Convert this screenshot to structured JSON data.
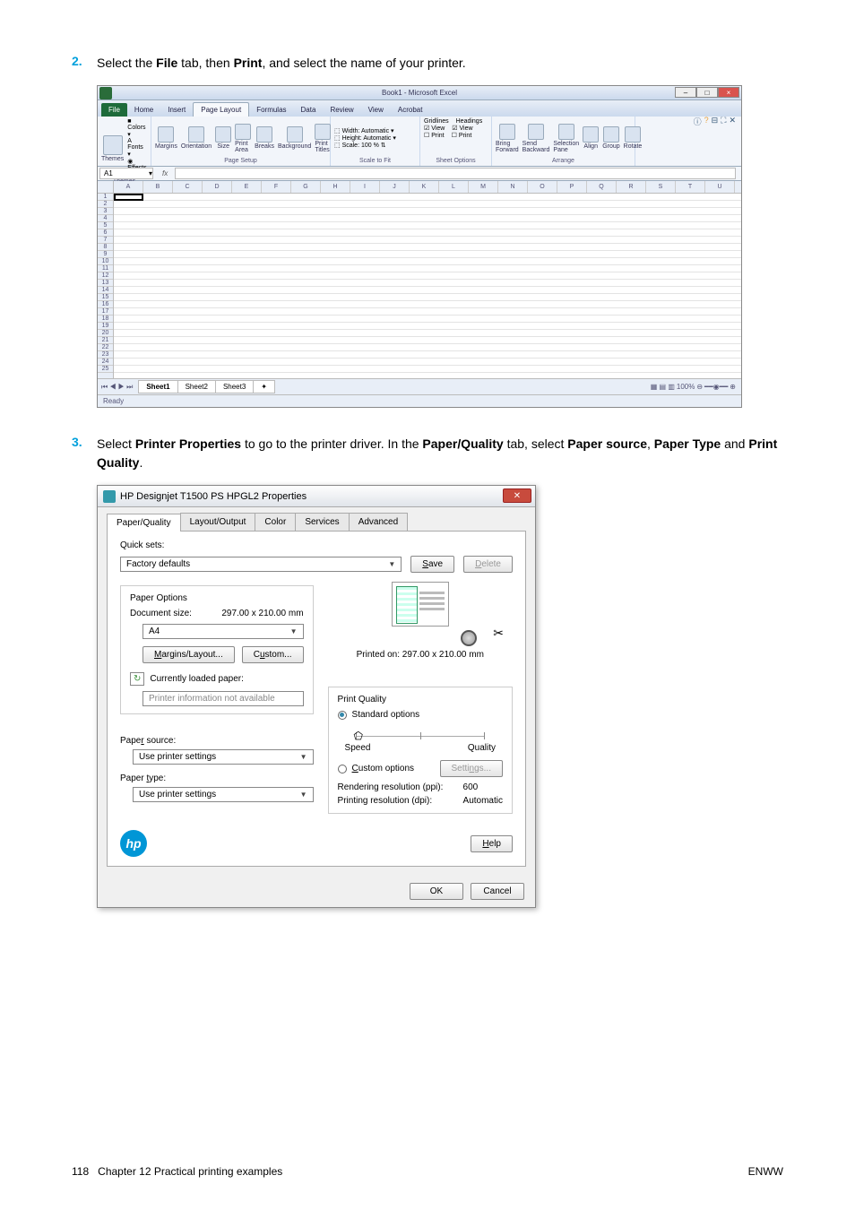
{
  "steps": {
    "s2": {
      "num": "2.",
      "text_before": "Select the ",
      "file": "File",
      "mid1": " tab, then ",
      "print": "Print",
      "after": ", and select the name of your printer."
    },
    "s3": {
      "num": "3.",
      "text_before": "Select ",
      "pp": "Printer Properties",
      "mid1": " to go to the printer driver. In the ",
      "pq": "Paper/Quality",
      "mid2": " tab, select ",
      "ps": "Paper source",
      "comma": ", ",
      "pt": "Paper Type",
      "and": " and ",
      "pq2": "Print Quality",
      "dot": "."
    }
  },
  "excel": {
    "title": "Book1 - Microsoft Excel",
    "tabs": [
      "File",
      "Home",
      "Insert",
      "Page Layout",
      "Formulas",
      "Data",
      "Review",
      "View",
      "Acrobat"
    ],
    "ribbon_groups": {
      "themes": {
        "label": "Themes",
        "items": [
          "Colors",
          "Fonts",
          "Effects"
        ],
        "main": "Themes"
      },
      "page_setup": {
        "label": "Page Setup",
        "items": [
          "Margins",
          "Orientation",
          "Size",
          "Print Area",
          "Breaks",
          "Background",
          "Print Titles"
        ]
      },
      "scale": {
        "label": "Scale to Fit",
        "width": "Width:",
        "width_val": "Automatic",
        "height": "Height:",
        "height_val": "Automatic",
        "scale": "Scale:",
        "scale_val": "100 %"
      },
      "sheet_options": {
        "label": "Sheet Options",
        "gridlines": "Gridlines",
        "headings": "Headings",
        "view": "View",
        "print": "Print"
      },
      "arrange": {
        "label": "Arrange",
        "items": [
          "Bring Forward",
          "Send Backward",
          "Selection Pane",
          "Align",
          "Group",
          "Rotate"
        ]
      }
    },
    "name_box": "A1",
    "fx": "fx",
    "columns": [
      "A",
      "B",
      "C",
      "D",
      "E",
      "F",
      "G",
      "H",
      "I",
      "J",
      "K",
      "L",
      "M",
      "N",
      "O",
      "P",
      "Q",
      "R",
      "S",
      "T",
      "U"
    ],
    "rows": [
      "1",
      "2",
      "3",
      "4",
      "5",
      "6",
      "7",
      "8",
      "9",
      "10",
      "11",
      "12",
      "13",
      "14",
      "15",
      "16",
      "17",
      "18",
      "19",
      "20",
      "21",
      "22",
      "23",
      "24",
      "25"
    ],
    "sheets": [
      "Sheet1",
      "Sheet2",
      "Sheet3"
    ],
    "status": "Ready",
    "zoom": "100%"
  },
  "dialog": {
    "title": "HP Designjet T1500 PS HPGL2 Properties",
    "tabs": [
      "Paper/Quality",
      "Layout/Output",
      "Color",
      "Services",
      "Advanced"
    ],
    "quicksets_label": "Quick sets:",
    "quickset_value": "Factory defaults",
    "save_btn": "Save",
    "delete_btn": "Delete",
    "paper_options": {
      "title": "Paper Options",
      "doc_size_label": "Document size:",
      "doc_size_val": "297.00 x 210.00 mm",
      "size_value": "A4",
      "margins_btn": "Margins/Layout...",
      "custom_btn": "Custom...",
      "loaded_label": "Currently loaded paper:",
      "info_na": "Printer information not available"
    },
    "printed_on": "Printed on: 297.00 x 210.00 mm",
    "paper_source_label": "Paper source:",
    "paper_source_val": "Use printer settings",
    "paper_type_label": "Paper type:",
    "paper_type_val": "Use printer settings",
    "print_quality": {
      "title": "Print Quality",
      "standard": "Standard options",
      "speed": "Speed",
      "quality": "Quality",
      "custom": "Custom options",
      "settings_btn": "Settings...",
      "render_res_label": "Rendering resolution (ppi):",
      "render_res_val": "600",
      "print_res_label": "Printing resolution (dpi):",
      "print_res_val": "Automatic"
    },
    "help_btn": "Help",
    "ok_btn": "OK",
    "cancel_btn": "Cancel"
  },
  "footer": {
    "left_page": "118",
    "left_chapter": "Chapter 12   Practical printing examples",
    "right": "ENWW"
  }
}
